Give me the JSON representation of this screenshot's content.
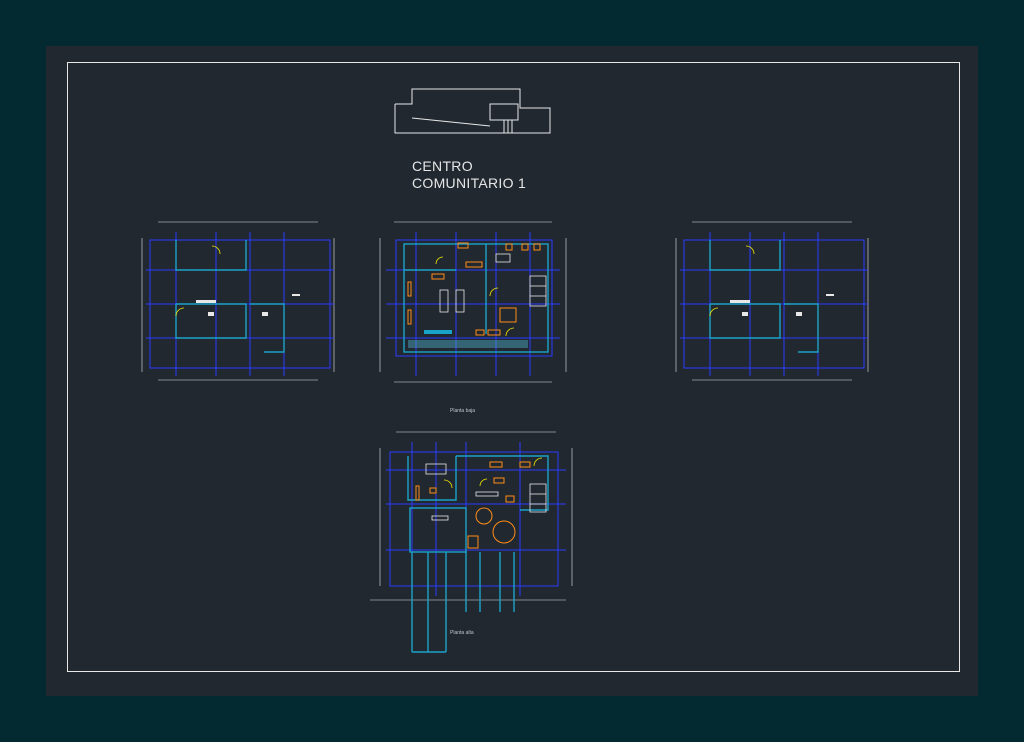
{
  "drawing": {
    "title_line1": "CENTRO",
    "title_line2": "COMUNITARIO 1",
    "caption_lower_level": "Planta baja",
    "caption_upper_level": "Planta alta"
  },
  "colors": {
    "background": "#022a30",
    "model_space": "#212830",
    "border": "#e8e8e8",
    "grid": "#2a3cff",
    "walls": "#1aa3c8",
    "furniture": "#ff8c1a",
    "doors": "#f2e600",
    "lines": "#ffffff"
  }
}
